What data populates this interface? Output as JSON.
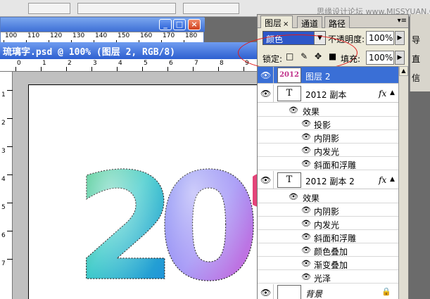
{
  "watermark": "思缘设计论坛 www.MISSYUAN.COM",
  "navigator": {
    "ruler_ticks": [
      "100",
      "110",
      "120",
      "130",
      "140",
      "150",
      "160",
      "170",
      "180"
    ],
    "controls": {
      "minimize": "_",
      "maximize": "□",
      "close": "×"
    }
  },
  "document": {
    "title": "琉璃字.psd @ 100% (图层 2, RGB/8)",
    "ruler_ticks": [
      "0",
      "1",
      "2",
      "3",
      "4",
      "5",
      "6",
      "7",
      "8",
      "9"
    ],
    "vruler_ticks": [
      "1",
      "2",
      "3",
      "4",
      "5",
      "6",
      "7"
    ],
    "art_text": "20"
  },
  "layers_panel": {
    "tabs": [
      {
        "label": "图层",
        "close": "×",
        "active": true
      },
      {
        "label": "通道",
        "active": false
      },
      {
        "label": "路径",
        "active": false
      }
    ],
    "menu_glyph": "▾≡",
    "blend_mode": "颜色",
    "opacity_label": "不透明度:",
    "opacity_value": "100%",
    "lock_label": "锁定:",
    "lock_icons": "□ ✎ ✥ ■",
    "fill_label": "填充:",
    "fill_value": "100%",
    "layers": [
      {
        "name": "图层 2",
        "thumb": "2012",
        "selected": true
      },
      {
        "name": "2012 副本",
        "thumb": "T",
        "fx": "fx",
        "effects_label": "效果",
        "effects": [
          "投影",
          "内阴影",
          "内发光",
          "斜面和浮雕"
        ]
      },
      {
        "name": "2012 副本 2",
        "thumb": "T",
        "fx": "fx",
        "effects_label": "效果",
        "effects": [
          "内阴影",
          "内发光",
          "斜面和浮雕",
          "颜色叠加",
          "渐变叠加",
          "光泽"
        ]
      },
      {
        "name": "背景",
        "thumb": "",
        "lock": "🔒"
      }
    ]
  },
  "right_strip": {
    "items": [
      "导",
      "直",
      "信"
    ]
  },
  "colors": {
    "title_blue": "#2d5fd0",
    "selection_blue": "#3a6fd6",
    "panel_bg": "#ece9d8",
    "annotation_red": "#e01a1a"
  }
}
